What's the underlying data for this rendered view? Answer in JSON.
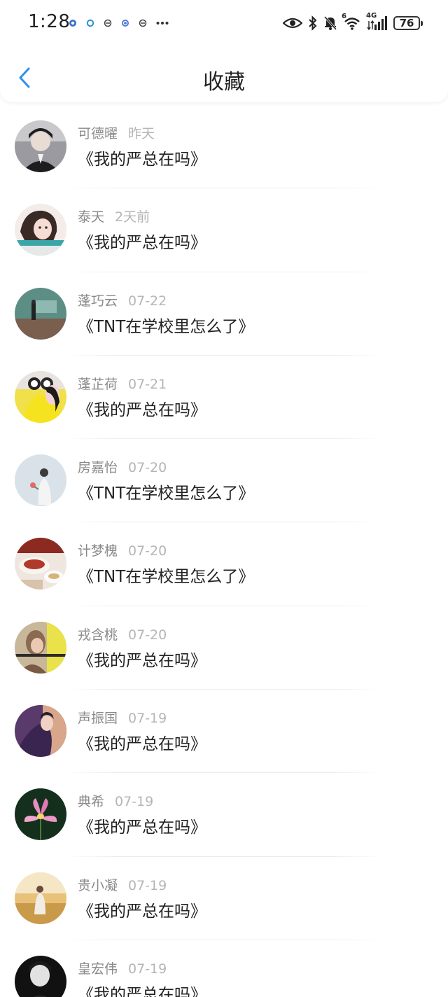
{
  "status_bar": {
    "time": "1:28",
    "network_label": "4G",
    "sim_label": "6",
    "battery": "76",
    "icons": [
      "app-notification-icon",
      "circle-notification-icon",
      "message-notification-icon",
      "app-notification-icon",
      "message-notification-icon",
      "more-dots-icon",
      "eye-icon",
      "bluetooth-icon",
      "mute-bell-icon",
      "wifi-icon",
      "signal-icon",
      "battery-icon"
    ]
  },
  "nav": {
    "title": "收藏",
    "back_icon": "chevron-left-icon"
  },
  "colors": {
    "accent": "#2f8ff0",
    "name": "#8a8a8a",
    "time": "#b5b5b5",
    "title": "#222222"
  },
  "favorites": [
    {
      "name": "可德曜",
      "time": "昨天",
      "title": "《我的严总在吗》"
    },
    {
      "name": "泰天",
      "time": "2天前",
      "title": "《我的严总在吗》"
    },
    {
      "name": "蓬巧云",
      "time": "07-22",
      "title": "《TNT在学校里怎么了》"
    },
    {
      "name": "蓬芷荷",
      "time": "07-21",
      "title": "《我的严总在吗》"
    },
    {
      "name": "房嘉怡",
      "time": "07-20",
      "title": "《TNT在学校里怎么了》"
    },
    {
      "name": "计梦槐",
      "time": "07-20",
      "title": "《TNT在学校里怎么了》"
    },
    {
      "name": "戎含桃",
      "time": "07-20",
      "title": "《我的严总在吗》"
    },
    {
      "name": "声振国",
      "time": "07-19",
      "title": "《我的严总在吗》"
    },
    {
      "name": "典希",
      "time": "07-19",
      "title": "《我的严总在吗》"
    },
    {
      "name": "贵小凝",
      "time": "07-19",
      "title": "《我的严总在吗》"
    },
    {
      "name": "皇宏伟",
      "time": "07-19",
      "title": "《我的严总在吗》"
    }
  ]
}
